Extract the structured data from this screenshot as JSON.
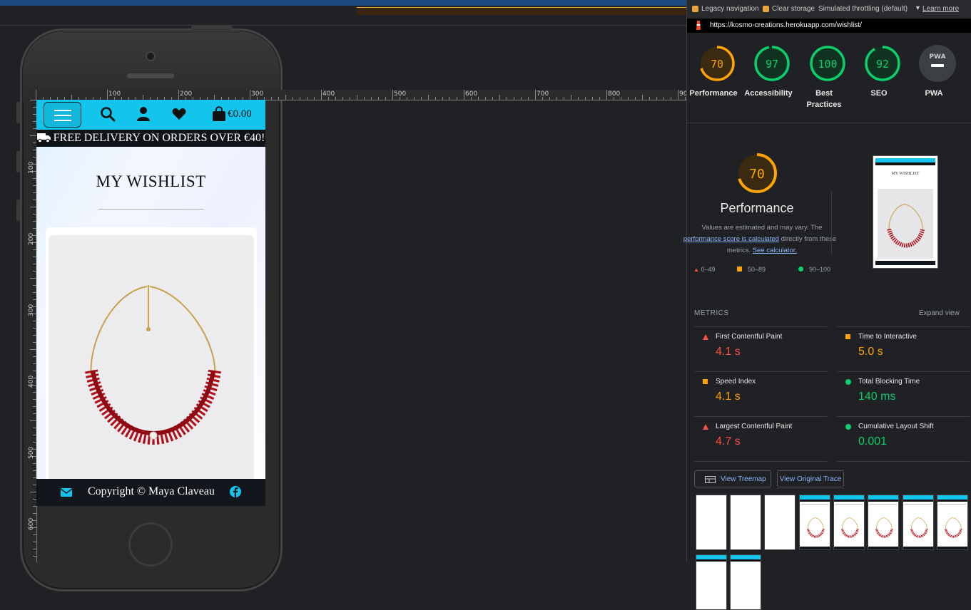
{
  "devtools": {
    "legacy_navigation": "Legacy navigation",
    "clear_storage": "Clear storage",
    "throttling": "Simulated throttling (default)",
    "learn_more": "Learn more",
    "url": "https://kosmo-creations.herokuapp.com/wishlist/"
  },
  "ruler": {
    "h_ticks": [
      "100",
      "200",
      "300",
      "400",
      "500",
      "600",
      "700",
      "800",
      "90"
    ],
    "v_ticks": [
      "100",
      "200",
      "300",
      "400",
      "500",
      "600"
    ]
  },
  "site": {
    "cart_amount": "€0.00",
    "delivery_banner": "FREE DELIVERY ON ORDERS OVER €40!",
    "page_title": "MY WISHLIST",
    "footer_text": "Copyright © Maya Claveau"
  },
  "scores": [
    {
      "label": "Performance",
      "value": "70",
      "score": 70,
      "color": "#ffa400"
    },
    {
      "label": "Accessibility",
      "value": "97",
      "score": 97,
      "color": "#0cce6b"
    },
    {
      "label": "Best Practices",
      "value": "100",
      "score": 100,
      "color": "#0cce6b"
    },
    {
      "label": "SEO",
      "value": "92",
      "score": 92,
      "color": "#0cce6b"
    },
    {
      "label": "PWA",
      "value": "PWA",
      "score": 0,
      "color": "#9aa0a6"
    }
  ],
  "performance": {
    "score": "70",
    "title": "Performance",
    "desc_1": "Values are estimated and may vary. The",
    "desc_link": "performance score is calculated",
    "desc_2": "directly from these",
    "desc_3": "metrics.",
    "see_calc": "See calculator.",
    "legend": [
      "0–49",
      "50–89",
      "90–100"
    ]
  },
  "metrics_header": "METRICS",
  "expand_view": "Expand view",
  "metrics": [
    {
      "label": "First Contentful Paint",
      "value": "4.1 s",
      "status": "fail",
      "color": "#ff4e42"
    },
    {
      "label": "Time to Interactive",
      "value": "5.0 s",
      "status": "average",
      "color": "#ffa400"
    },
    {
      "label": "Speed Index",
      "value": "4.1 s",
      "status": "average",
      "color": "#ffa400"
    },
    {
      "label": "Total Blocking Time",
      "value": "140 ms",
      "status": "pass",
      "color": "#0cce6b"
    },
    {
      "label": "Largest Contentful Paint",
      "value": "4.7 s",
      "status": "fail",
      "color": "#ff4e42"
    },
    {
      "label": "Cumulative Layout Shift",
      "value": "0.001",
      "status": "pass",
      "color": "#0cce6b"
    }
  ],
  "buttons": {
    "treemap": "View Treemap",
    "trace": "View Original Trace"
  }
}
